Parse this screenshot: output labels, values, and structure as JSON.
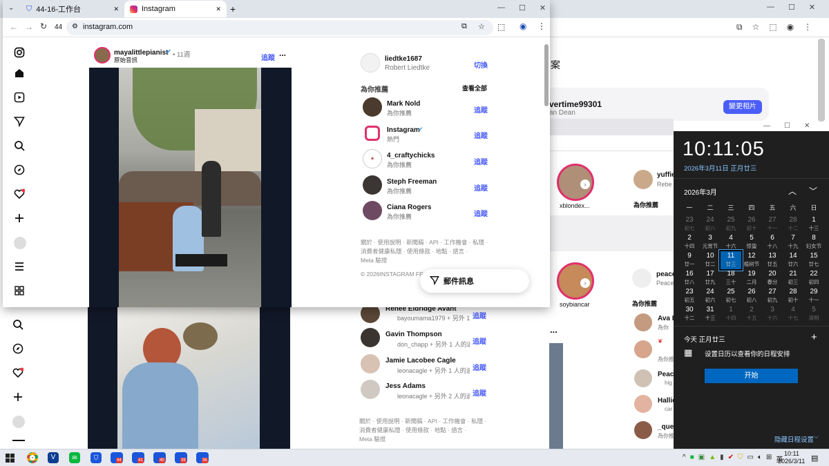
{
  "back_window": {
    "address_icons": [
      "cast-icon",
      "star-icon",
      "extension-icon",
      "profile-icon",
      "menu-icon"
    ],
    "section_title_fragment": "案",
    "profile_card": {
      "username_fragment": "vertime99301",
      "name_fragment": "an Dean",
      "button": "變更相片"
    },
    "stories_row1": [
      {
        "name": "xblondex..."
      },
      {
        "name": "yuffie",
        "sub": "Rebe"
      }
    ],
    "stories_row2": [
      {
        "name": "soybiancar"
      },
      {
        "name": "peace",
        "sub": "Peace"
      }
    ],
    "recommend_label_1": "為你推薦",
    "recommend_label_2": "為你推薦",
    "right_list": [
      {
        "name": "Ava I",
        "sub": "為你"
      },
      {
        "name": "",
        "sub": "為你推"
      },
      {
        "name": "Peach",
        "sub": "hig"
      },
      {
        "name": "Hallie",
        "sub": "car"
      },
      {
        "name": "_quee",
        "sub": "為你推"
      }
    ],
    "lower_suggestions": [
      {
        "name": "Renee Eldridge Avant",
        "sub": "bayoumama1979 + 另外 1 人",
        "follow": "追蹤"
      },
      {
        "name": "Gavin Thompson",
        "sub": "don_chapp + 另外 1 人的追蹤",
        "follow": "追蹤"
      },
      {
        "name": "Jamie Lacobee Cagle",
        "sub": "leonacagle + 另外 1 人的追蹤",
        "follow": "追蹤"
      },
      {
        "name": "Jess Adams",
        "sub": "leonacagle + 另外 2 人的追蹤",
        "follow": "追蹤"
      }
    ],
    "lower_footer": [
      "關於 · 使用說明 · 新聞稿 · API · 工作機會 · 私隱 ·",
      "消費者健康私隱 · 使用條款 · 地點 · 語言 ·",
      "Meta 驗證"
    ],
    "more_dots": "..."
  },
  "front_window": {
    "tabs": [
      {
        "label": "44-16-工作台"
      },
      {
        "label": "Instagram"
      }
    ],
    "new_tab": "+",
    "address": {
      "prefix": "44",
      "url": "instagram.com"
    },
    "window_controls": [
      "minimize-icon",
      "maximize-icon",
      "close-icon"
    ],
    "post": {
      "username": "mayalittlepianist",
      "dot_time": "• 11週",
      "subtitle": "原始音訊",
      "follow": "追蹤",
      "more": "..."
    },
    "account": {
      "username": "liedtke1687",
      "name": "Robert Liedtke",
      "switch": "切換"
    },
    "suggestions_header": {
      "title": "為你推薦",
      "see_all": "查看全部"
    },
    "suggestions": [
      {
        "name": "Mark Nold",
        "sub": "為你推薦",
        "follow": "追蹤"
      },
      {
        "name": "Instagram",
        "sub": "熱門",
        "follow": "追蹤",
        "verified": true
      },
      {
        "name": "4_craftychicks",
        "sub": "為你推薦",
        "follow": "追蹤"
      },
      {
        "name": "Steph Freeman",
        "sub": "為你推薦",
        "follow": "追蹤"
      },
      {
        "name": "Ciana Rogers",
        "sub": "為你推薦",
        "follow": "追蹤"
      }
    ],
    "footer_lines": [
      "關於 · 使用說明 · 新聞稿 · API · 工作機會 · 私隱 ·",
      "消費者健康私隱 · 使用條款 · 地點 · 語言 ·",
      "Meta 驗證"
    ],
    "copyright": "© 2026INSTAGRAM FRO",
    "messages_button": "郵件訊息"
  },
  "calendar_panel": {
    "time": "10:11:05",
    "date_line": "2026年3月11日 正月廿三",
    "month_title": "2026年3月",
    "weekdays": [
      "一",
      "二",
      "三",
      "四",
      "五",
      "六",
      "日"
    ],
    "weeks": [
      [
        {
          "d": "23",
          "l": "初七",
          "dim": true
        },
        {
          "d": "24",
          "l": "初八",
          "dim": true
        },
        {
          "d": "25",
          "l": "初九",
          "dim": true
        },
        {
          "d": "26",
          "l": "初十",
          "dim": true
        },
        {
          "d": "27",
          "l": "十一",
          "dim": true
        },
        {
          "d": "28",
          "l": "十二",
          "dim": true
        },
        {
          "d": "1",
          "l": "十三"
        }
      ],
      [
        {
          "d": "2",
          "l": "十四"
        },
        {
          "d": "3",
          "l": "元宵节"
        },
        {
          "d": "4",
          "l": "十六"
        },
        {
          "d": "5",
          "l": "惊蛰"
        },
        {
          "d": "6",
          "l": "十八"
        },
        {
          "d": "7",
          "l": "十九"
        },
        {
          "d": "8",
          "l": "妇女节"
        }
      ],
      [
        {
          "d": "9",
          "l": "廿一"
        },
        {
          "d": "10",
          "l": "廿二"
        },
        {
          "d": "11",
          "l": "廿三",
          "today": true
        },
        {
          "d": "12",
          "l": "植树节"
        },
        {
          "d": "13",
          "l": "廿五"
        },
        {
          "d": "14",
          "l": "廿六"
        },
        {
          "d": "15",
          "l": "廿七"
        }
      ],
      [
        {
          "d": "16",
          "l": "廿八"
        },
        {
          "d": "17",
          "l": "廿九"
        },
        {
          "d": "18",
          "l": "三十"
        },
        {
          "d": "19",
          "l": "二月"
        },
        {
          "d": "20",
          "l": "春分"
        },
        {
          "d": "21",
          "l": "初三"
        },
        {
          "d": "22",
          "l": "初四"
        }
      ],
      [
        {
          "d": "23",
          "l": "初五"
        },
        {
          "d": "24",
          "l": "初六"
        },
        {
          "d": "25",
          "l": "初七"
        },
        {
          "d": "26",
          "l": "初八"
        },
        {
          "d": "27",
          "l": "初九"
        },
        {
          "d": "28",
          "l": "初十"
        },
        {
          "d": "29",
          "l": "十一"
        }
      ],
      [
        {
          "d": "30",
          "l": "十二"
        },
        {
          "d": "31",
          "l": "十三"
        },
        {
          "d": "1",
          "l": "十四",
          "dim": true
        },
        {
          "d": "2",
          "l": "十五",
          "dim": true
        },
        {
          "d": "3",
          "l": "十六",
          "dim": true
        },
        {
          "d": "4",
          "l": "十七",
          "dim": true
        },
        {
          "d": "5",
          "l": "清明",
          "dim": true
        }
      ]
    ],
    "agenda_title": "今天 正月廿三",
    "agenda_add": "+",
    "agenda_text": "设置日历以查看你的日程安排",
    "start_button": "开始",
    "hide_link": "隐藏日程设置"
  },
  "taskbar": {
    "badges": [
      "44",
      "41",
      "40",
      "39",
      "36"
    ],
    "lang": "英",
    "time": "10:11",
    "date": "2026/3/11"
  }
}
